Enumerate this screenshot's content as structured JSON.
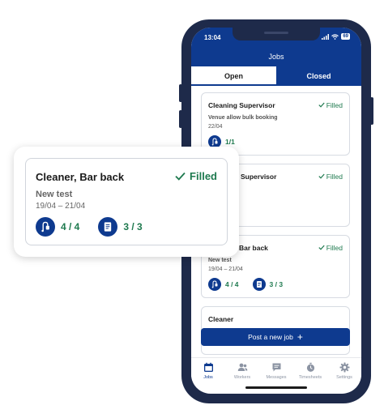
{
  "status_bar": {
    "time": "13:04",
    "battery": "69"
  },
  "app": {
    "title": "Jobs"
  },
  "tabs": [
    {
      "label": "Open"
    },
    {
      "label": "Closed"
    }
  ],
  "jobs": [
    {
      "title": "Cleaning Supervisor",
      "status": "Filled",
      "subtitle": "Venue allow bulk booking",
      "dates": "22/04",
      "workers": "1/1",
      "timesheets": ""
    },
    {
      "title": "Supervisor",
      "status": "Filled",
      "subtitle": "",
      "dates": "",
      "workers": "",
      "timesheets": ""
    },
    {
      "title": "Bar back",
      "status": "Filled",
      "subtitle": "New test",
      "dates": "19/04 – 21/04",
      "workers": "4 / 4",
      "timesheets": "3 / 3"
    },
    {
      "title": "Cleaner",
      "status": "",
      "subtitle": "",
      "dates": "",
      "workers": "",
      "timesheets": ""
    }
  ],
  "post_button": {
    "label": "Post a new job"
  },
  "bottom_nav": [
    {
      "label": "Jobs",
      "icon": "calendar-icon"
    },
    {
      "label": "Workers",
      "icon": "workers-icon"
    },
    {
      "label": "Messages",
      "icon": "messages-icon"
    },
    {
      "label": "Timesheets",
      "icon": "stopwatch-icon"
    },
    {
      "label": "Settings",
      "icon": "gear-icon"
    }
  ],
  "highlight_card": {
    "title": "Cleaner, Bar back",
    "status": "Filled",
    "subtitle": "New test",
    "dates": "19/04 – 21/04",
    "workers": "4 / 4",
    "timesheets": "3 / 3"
  },
  "colors": {
    "primary": "#0e3a8f",
    "success": "#1f7a4f",
    "frame": "#1e2a4a"
  }
}
